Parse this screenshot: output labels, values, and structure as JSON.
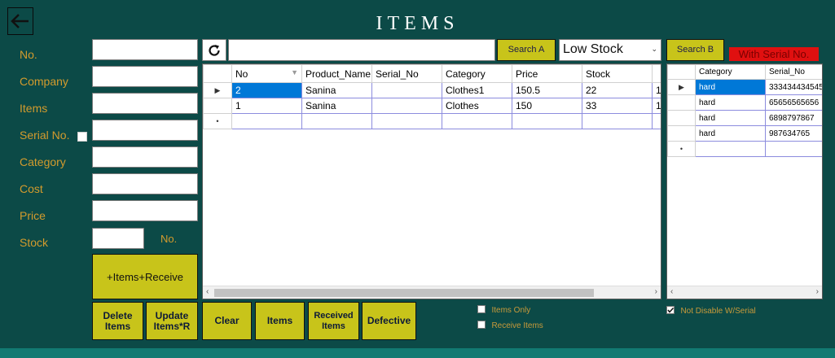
{
  "title": "ITEMS",
  "form": {
    "labels": [
      "No.",
      "Company",
      "Items",
      "Serial No.",
      "Category",
      "Cost",
      "Price",
      "Stock"
    ],
    "stock_suffix": "No.",
    "add_button": "+Items+Receive",
    "delete_button_line1": "Delete",
    "delete_button_line2": "Items",
    "update_button_line1": "Update",
    "update_button_line2": "Items*R"
  },
  "toolbar": {
    "search_a": "Search A",
    "filter_select": "Low Stock",
    "search_b": "Search B",
    "with_serial": "With Serial No."
  },
  "main_table": {
    "columns": [
      "No",
      "Product_Name",
      "Serial_No",
      "Category",
      "Price",
      "Stock"
    ],
    "rows": [
      {
        "no": "2",
        "product": "Sanina",
        "serial": "",
        "category": "Clothes1",
        "price": "150.5",
        "stock": "22",
        "extra": "1"
      },
      {
        "no": "1",
        "product": "Sanina",
        "serial": "",
        "category": "Clothes",
        "price": "150",
        "stock": "33",
        "extra": "1"
      }
    ]
  },
  "serial_table": {
    "columns": [
      "Category",
      "Serial_No"
    ],
    "rows": [
      {
        "category": "hard",
        "serial": "333434434545"
      },
      {
        "category": "hard",
        "serial": "65656565656"
      },
      {
        "category": "hard",
        "serial": "6898797867"
      },
      {
        "category": "hard",
        "serial": "987634765"
      }
    ]
  },
  "bottom_buttons": {
    "clear": "Clear",
    "items": "Items",
    "received_line1": "Received",
    "received_line2": "Items",
    "defective": "Defective"
  },
  "checkboxes": {
    "items_only": "Items Only",
    "receive_items": "Receive Items",
    "not_disable": "Not Disable W/Serial"
  },
  "colors": {
    "background": "#0c4a47",
    "button": "#c8c41a",
    "label": "#d39b2d",
    "selection": "#0078d7",
    "alert": "#e01010"
  }
}
